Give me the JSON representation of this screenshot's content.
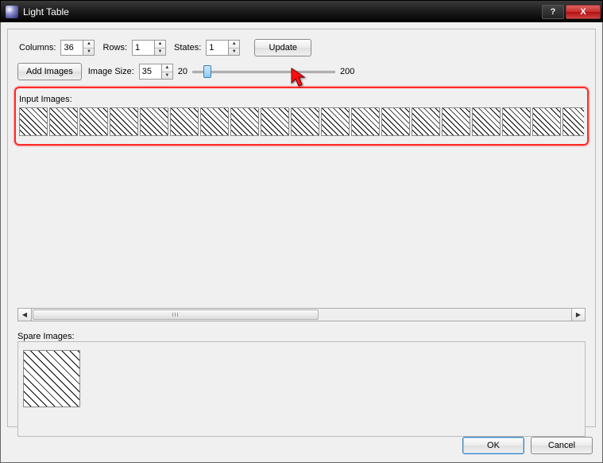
{
  "window": {
    "title": "Light Table",
    "help_hint": "?",
    "close_hint": "X"
  },
  "controls": {
    "columns_label": "Columns:",
    "columns_value": "36",
    "rows_label": "Rows:",
    "rows_value": "1",
    "states_label": "States:",
    "states_value": "1",
    "update_label": "Update",
    "add_images_label": "Add Images",
    "image_size_label": "Image Size:",
    "image_size_value": "35",
    "slider_min": "20",
    "slider_max": "200"
  },
  "groups": {
    "input_images_label": "Input Images:",
    "spare_images_label": "Spare Images:"
  },
  "thumbs": {
    "input_count": 20,
    "spare_count": 1
  },
  "footer": {
    "ok_label": "OK",
    "cancel_label": "Cancel"
  }
}
